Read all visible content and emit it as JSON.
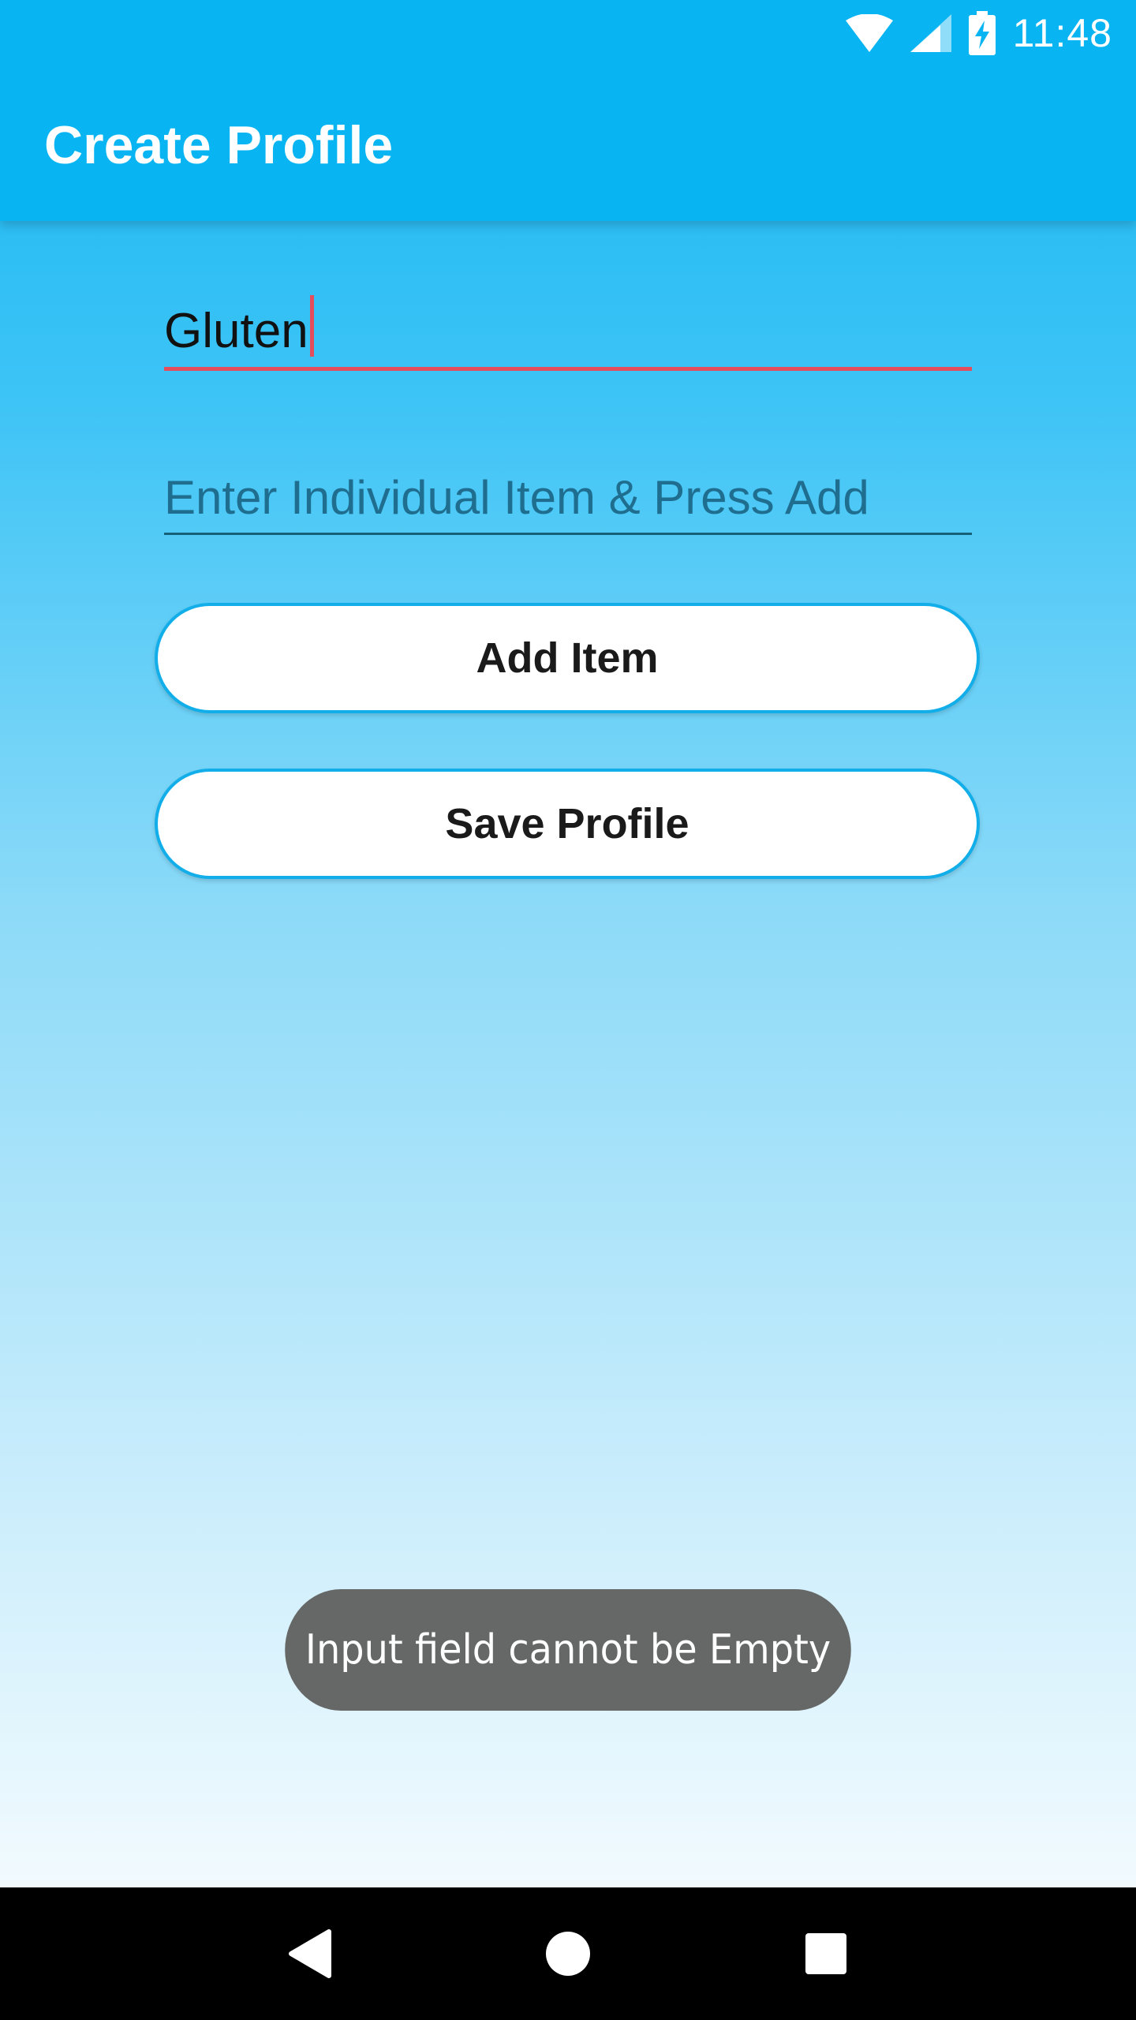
{
  "status_bar": {
    "time": "11:48",
    "icons": [
      "wifi-icon",
      "signal-icon",
      "battery-charging-icon"
    ]
  },
  "app_bar": {
    "title": "Create Profile",
    "color": "#09b4f2"
  },
  "form": {
    "item_field": {
      "value": "Gluten",
      "underline_color": "#e44d5c"
    },
    "entry_field": {
      "placeholder": "Enter Individual Item & Press Add",
      "value": ""
    },
    "add_button_label": "Add Item",
    "save_button_label": "Save Profile"
  },
  "toast": {
    "message": "Input field cannot be Empty"
  },
  "nav_bar": {
    "icons": [
      "back-icon",
      "home-icon",
      "recents-icon"
    ]
  }
}
